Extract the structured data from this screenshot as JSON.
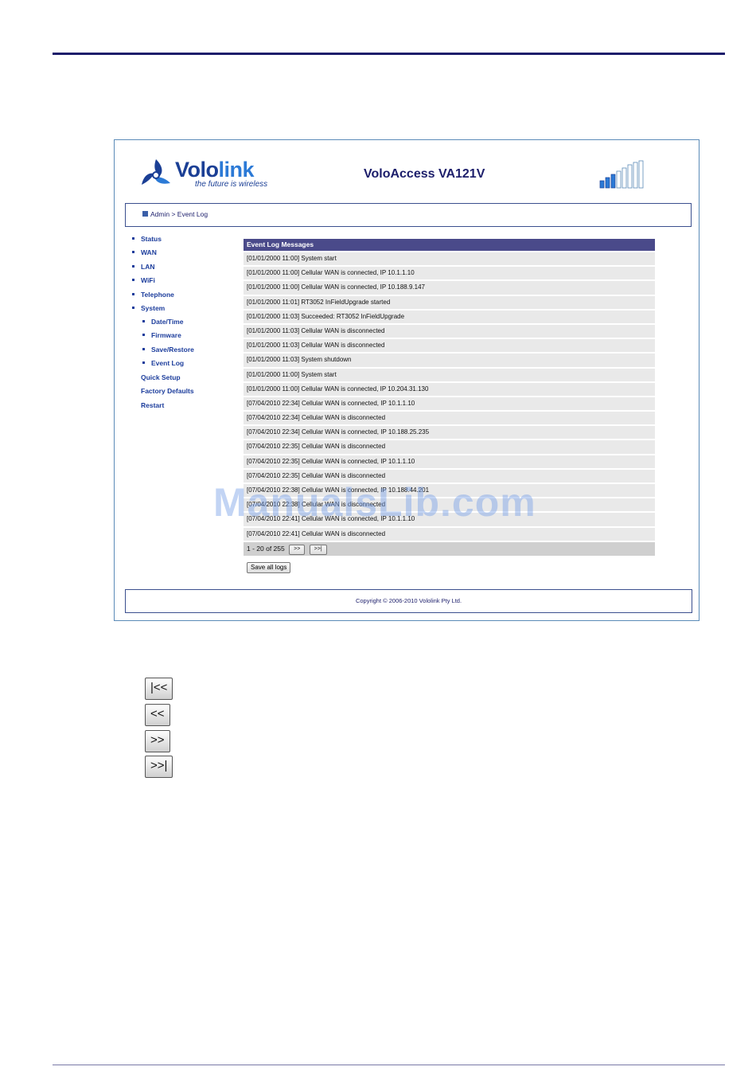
{
  "header": {
    "brand_word_a": "Volo",
    "brand_word_b": "link",
    "tagline": "the future is wireless",
    "device_title": "VoloAccess VA121V"
  },
  "breadcrumb": {
    "text": "Admin > Event Log"
  },
  "nav": {
    "items": [
      {
        "label": "Status"
      },
      {
        "label": "WAN"
      },
      {
        "label": "LAN"
      },
      {
        "label": "WiFi"
      },
      {
        "label": "Telephone"
      },
      {
        "label": "System"
      },
      {
        "label": "Date/Time"
      },
      {
        "label": "Firmware"
      },
      {
        "label": "Save/Restore"
      },
      {
        "label": "Event Log"
      },
      {
        "label": "Quick Setup"
      },
      {
        "label": "Factory Defaults"
      },
      {
        "label": "Restart"
      }
    ]
  },
  "event_log": {
    "title": "Event Log Messages",
    "rows": [
      "[01/01/2000 11:00] System start",
      "[01/01/2000 11:00] Cellular WAN is connected, IP 10.1.1.10",
      "[01/01/2000 11:00] Cellular WAN is connected, IP 10.188.9.147",
      "[01/01/2000 11:01] RT3052 InFieldUpgrade started",
      "[01/01/2000 11:03] Succeeded: RT3052 InFieldUpgrade",
      "[01/01/2000 11:03] Cellular WAN is disconnected",
      "[01/01/2000 11:03] Cellular WAN is disconnected",
      "[01/01/2000 11:03] System shutdown",
      "[01/01/2000 11:00] System start",
      "[01/01/2000 11:00] Cellular WAN is connected, IP 10.204.31.130",
      "[07/04/2010 22:34] Cellular WAN is connected, IP 10.1.1.10",
      "[07/04/2010 22:34] Cellular WAN is disconnected",
      "[07/04/2010 22:34] Cellular WAN is connected, IP 10.188.25.235",
      "[07/04/2010 22:35] Cellular WAN is disconnected",
      "[07/04/2010 22:35] Cellular WAN is connected, IP 10.1.1.10",
      "[07/04/2010 22:35] Cellular WAN is disconnected",
      "[07/04/2010 22:38] Cellular WAN is connected, IP 10.188.44.201",
      "[07/04/2010 22:38] Cellular WAN is disconnected",
      "[07/04/2010 22:41] Cellular WAN is connected, IP 10.1.1.10",
      "[07/04/2010 22:41] Cellular WAN is disconnected"
    ],
    "pager_text": "1 - 20 of 255",
    "next_label": ">>",
    "last_label": ">>|",
    "save_label": "Save all logs"
  },
  "footer": {
    "copyright": "Copyright © 2006-2010 Vololink Pty Ltd."
  },
  "watermark": "ManualsLib.com",
  "legend_buttons": {
    "first": "|<<",
    "prev": "<<",
    "next": ">>",
    "last": ">>|"
  },
  "colors": {
    "brand_dark": "#1b3f95",
    "brand_light": "#2c7ad6",
    "header_bar": "#4a4a8a",
    "nav_link": "#1c3d9c"
  }
}
